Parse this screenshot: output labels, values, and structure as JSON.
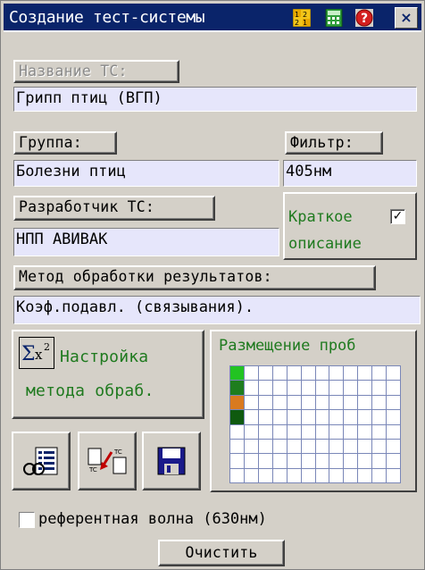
{
  "title": "Создание тест-системы",
  "titlebar_icons": [
    "numbers-icon",
    "calculator-icon",
    "help-icon",
    "close-icon"
  ],
  "close_label": "×",
  "name_button": "Название ТС:",
  "name_value": "Грипп птиц (ВГП)",
  "group_button": "Группа:",
  "group_value": "Болезни птиц",
  "filter_button": "Фильтр:",
  "filter_value": "405нм",
  "developer_button": "Разработчик ТС:",
  "developer_value": "НПП АВИВАК",
  "short_desc_line1": "Краткое",
  "short_desc_line2": "описание",
  "short_desc_checked": true,
  "method_button": "Метод обработки результатов:",
  "method_value": "Коэф.подавл. (связывания).",
  "method_settings_line1": "Настройка",
  "method_settings_line2": "метода обраб.",
  "placement_title": "Размещение проб",
  "plate": {
    "columns": 12,
    "rows": 8,
    "filled_cells": [
      {
        "row": 0,
        "col": 0,
        "color": "#22c322"
      },
      {
        "row": 1,
        "col": 0,
        "color": "#1e7d1e"
      },
      {
        "row": 2,
        "col": 0,
        "color": "#d97a1f"
      },
      {
        "row": 3,
        "col": 0,
        "color": "#0f5a0f"
      }
    ]
  },
  "reference_wave_label": "референтная волна (630нм)",
  "reference_wave_checked": false,
  "clear_button": "Очистить",
  "toolbar_icons": [
    "report-icon",
    "copy-to-tc-icon",
    "save-icon"
  ],
  "colors": {
    "titlebar": "#0a246a",
    "field_bg": "#e6e6fb",
    "green_text": "#1f7a1f",
    "grid_line": "#7a87b8"
  }
}
